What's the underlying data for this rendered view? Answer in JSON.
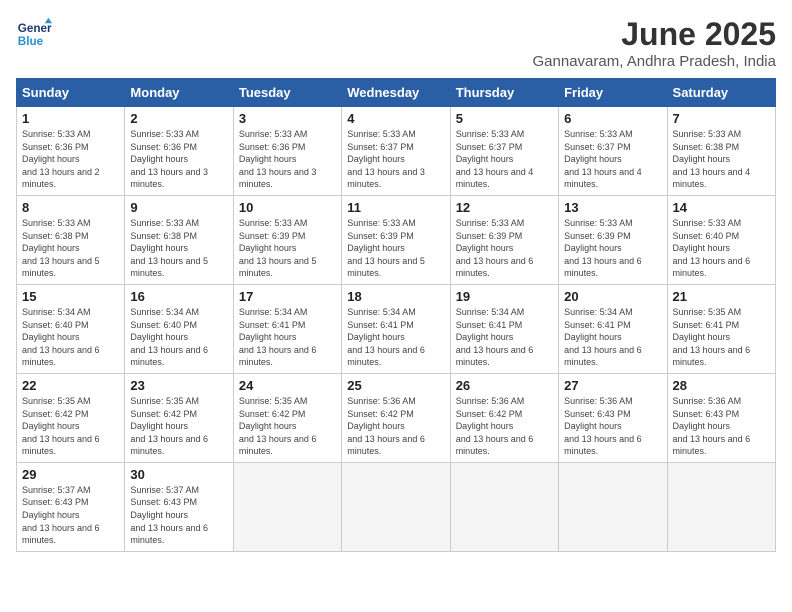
{
  "logo": {
    "line1": "General",
    "line2": "Blue"
  },
  "title": "June 2025",
  "subtitle": "Gannavaram, Andhra Pradesh, India",
  "headers": [
    "Sunday",
    "Monday",
    "Tuesday",
    "Wednesday",
    "Thursday",
    "Friday",
    "Saturday"
  ],
  "weeks": [
    [
      {
        "day": "1",
        "rise": "5:33 AM",
        "set": "6:36 PM",
        "daylight": "13 hours and 2 minutes."
      },
      {
        "day": "2",
        "rise": "5:33 AM",
        "set": "6:36 PM",
        "daylight": "13 hours and 3 minutes."
      },
      {
        "day": "3",
        "rise": "5:33 AM",
        "set": "6:36 PM",
        "daylight": "13 hours and 3 minutes."
      },
      {
        "day": "4",
        "rise": "5:33 AM",
        "set": "6:37 PM",
        "daylight": "13 hours and 3 minutes."
      },
      {
        "day": "5",
        "rise": "5:33 AM",
        "set": "6:37 PM",
        "daylight": "13 hours and 4 minutes."
      },
      {
        "day": "6",
        "rise": "5:33 AM",
        "set": "6:37 PM",
        "daylight": "13 hours and 4 minutes."
      },
      {
        "day": "7",
        "rise": "5:33 AM",
        "set": "6:38 PM",
        "daylight": "13 hours and 4 minutes."
      }
    ],
    [
      {
        "day": "8",
        "rise": "5:33 AM",
        "set": "6:38 PM",
        "daylight": "13 hours and 5 minutes."
      },
      {
        "day": "9",
        "rise": "5:33 AM",
        "set": "6:38 PM",
        "daylight": "13 hours and 5 minutes."
      },
      {
        "day": "10",
        "rise": "5:33 AM",
        "set": "6:39 PM",
        "daylight": "13 hours and 5 minutes."
      },
      {
        "day": "11",
        "rise": "5:33 AM",
        "set": "6:39 PM",
        "daylight": "13 hours and 5 minutes."
      },
      {
        "day": "12",
        "rise": "5:33 AM",
        "set": "6:39 PM",
        "daylight": "13 hours and 6 minutes."
      },
      {
        "day": "13",
        "rise": "5:33 AM",
        "set": "6:39 PM",
        "daylight": "13 hours and 6 minutes."
      },
      {
        "day": "14",
        "rise": "5:33 AM",
        "set": "6:40 PM",
        "daylight": "13 hours and 6 minutes."
      }
    ],
    [
      {
        "day": "15",
        "rise": "5:34 AM",
        "set": "6:40 PM",
        "daylight": "13 hours and 6 minutes."
      },
      {
        "day": "16",
        "rise": "5:34 AM",
        "set": "6:40 PM",
        "daylight": "13 hours and 6 minutes."
      },
      {
        "day": "17",
        "rise": "5:34 AM",
        "set": "6:41 PM",
        "daylight": "13 hours and 6 minutes."
      },
      {
        "day": "18",
        "rise": "5:34 AM",
        "set": "6:41 PM",
        "daylight": "13 hours and 6 minutes."
      },
      {
        "day": "19",
        "rise": "5:34 AM",
        "set": "6:41 PM",
        "daylight": "13 hours and 6 minutes."
      },
      {
        "day": "20",
        "rise": "5:34 AM",
        "set": "6:41 PM",
        "daylight": "13 hours and 6 minutes."
      },
      {
        "day": "21",
        "rise": "5:35 AM",
        "set": "6:41 PM",
        "daylight": "13 hours and 6 minutes."
      }
    ],
    [
      {
        "day": "22",
        "rise": "5:35 AM",
        "set": "6:42 PM",
        "daylight": "13 hours and 6 minutes."
      },
      {
        "day": "23",
        "rise": "5:35 AM",
        "set": "6:42 PM",
        "daylight": "13 hours and 6 minutes."
      },
      {
        "day": "24",
        "rise": "5:35 AM",
        "set": "6:42 PM",
        "daylight": "13 hours and 6 minutes."
      },
      {
        "day": "25",
        "rise": "5:36 AM",
        "set": "6:42 PM",
        "daylight": "13 hours and 6 minutes."
      },
      {
        "day": "26",
        "rise": "5:36 AM",
        "set": "6:42 PM",
        "daylight": "13 hours and 6 minutes."
      },
      {
        "day": "27",
        "rise": "5:36 AM",
        "set": "6:43 PM",
        "daylight": "13 hours and 6 minutes."
      },
      {
        "day": "28",
        "rise": "5:36 AM",
        "set": "6:43 PM",
        "daylight": "13 hours and 6 minutes."
      }
    ],
    [
      {
        "day": "29",
        "rise": "5:37 AM",
        "set": "6:43 PM",
        "daylight": "13 hours and 6 minutes."
      },
      {
        "day": "30",
        "rise": "5:37 AM",
        "set": "6:43 PM",
        "daylight": "13 hours and 6 minutes."
      },
      null,
      null,
      null,
      null,
      null
    ]
  ]
}
